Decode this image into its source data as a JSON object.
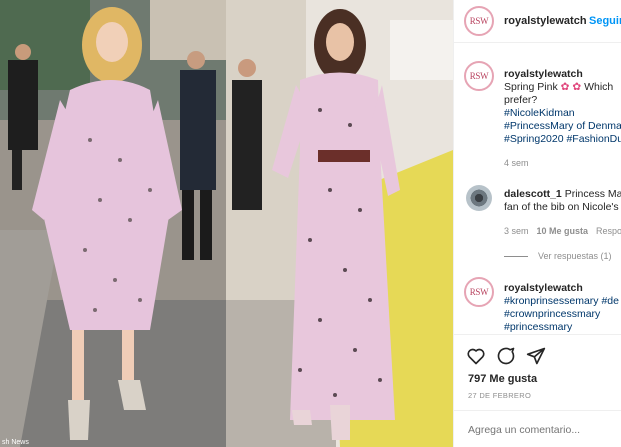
{
  "post": {
    "username": "royalstylewatch",
    "follow_label": "Seguir",
    "avatar_text": "RSW",
    "photo_credit": "sh News"
  },
  "caption": {
    "username": "royalstylewatch",
    "text_line1": "Spring Pink",
    "text_line1_after": "Which",
    "text_line2": "prefer?",
    "tags": [
      "#NicoleKidman",
      "#PrincessMary of Denma",
      "#Spring2020 #FashionDu"
    ],
    "age": "4 sem"
  },
  "comment": {
    "username": "dalescott_1",
    "text_line1": "Princess Mary",
    "text_line2": "fan of the bib on Nicole's",
    "age": "3 sem",
    "likes": "10 Me gusta",
    "reply_label": "Respo",
    "view_replies": "Ver respuestas (1)"
  },
  "comment2": {
    "username": "royalstylewatch",
    "tags": [
      "#kronprinsessemary #de",
      "#crownprincessmary",
      "#princessmary"
    ]
  },
  "actions": {
    "likes_count": "797 Me gusta",
    "date": "27 DE FEBRERO",
    "add_comment_placeholder": "Agrega un comentario..."
  },
  "colors": {
    "link": "#00376b",
    "follow": "#0095f6",
    "muted": "#8e8e8e",
    "dress_pink": "#e8c7dc"
  }
}
